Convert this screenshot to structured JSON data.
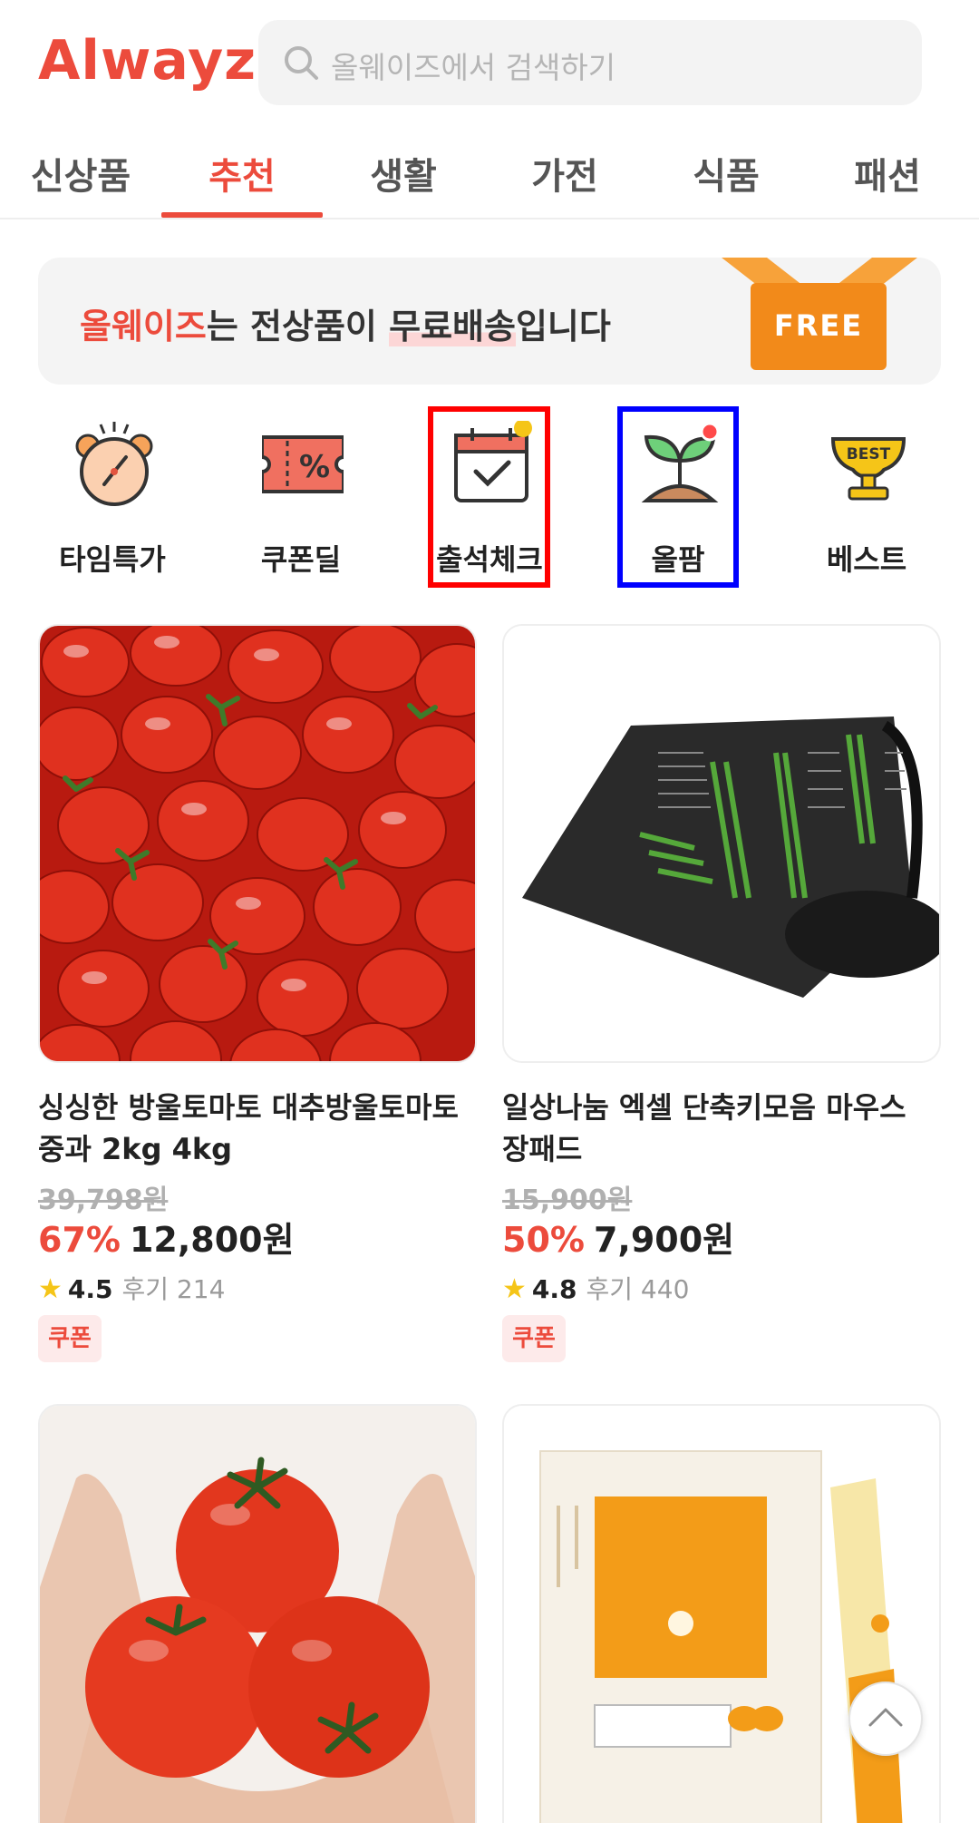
{
  "header": {
    "logo": "Alwayz",
    "search_placeholder": "올웨이즈에서 검색하기"
  },
  "tabs": [
    {
      "label": "신상품",
      "active": false
    },
    {
      "label": "추천",
      "active": true
    },
    {
      "label": "생활",
      "active": false
    },
    {
      "label": "가전",
      "active": false
    },
    {
      "label": "식품",
      "active": false
    },
    {
      "label": "패션",
      "active": false
    }
  ],
  "banner": {
    "brand": "올웨이즈",
    "text_a": "는 전상품이 ",
    "highlight": "무료배송",
    "text_b": "입니다",
    "badge": "FREE"
  },
  "categories": [
    {
      "label": "타임특가",
      "icon": "alarm-clock-icon"
    },
    {
      "label": "쿠폰딜",
      "icon": "coupon-percent-icon"
    },
    {
      "label": "출석체크",
      "icon": "calendar-check-icon"
    },
    {
      "label": "올팜",
      "icon": "sprout-icon"
    },
    {
      "label": "베스트",
      "icon": "best-trophy-icon"
    }
  ],
  "products": [
    {
      "title": "싱싱한 방울토마토 대추방울토마토 중과 2kg 4kg",
      "original_price": "39,798원",
      "discount": "67%",
      "price": "12,800원",
      "rating": "4.5",
      "reviews": "후기 214",
      "badge": "쿠폰"
    },
    {
      "title": "일상나눔 엑셀 단축키모음 마우스 장패드",
      "original_price": "15,900원",
      "discount": "50%",
      "price": "7,900원",
      "rating": "4.8",
      "reviews": "후기 440",
      "badge": "쿠폰"
    }
  ],
  "colors": {
    "accent": "#ec4b3c",
    "free_badge": "#f28a1a",
    "star": "#f5c518"
  }
}
